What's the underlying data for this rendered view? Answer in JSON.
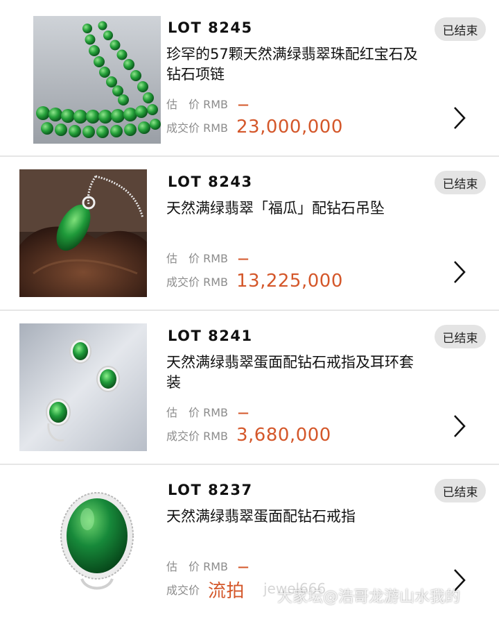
{
  "lots": [
    {
      "lot": "LOT 8245",
      "title": "珍罕的57颗天然满绿翡翠珠配红宝石及钻石项链",
      "status": "已结束",
      "estimate_label": "估　价 RMB",
      "estimate_value": "—",
      "sold_label": "成交价 RMB",
      "sold_value": "23,000,000"
    },
    {
      "lot": "LOT 8243",
      "title": "天然满绿翡翠「福瓜」配钻石吊坠",
      "status": "已结束",
      "estimate_label": "估　价 RMB",
      "estimate_value": "—",
      "sold_label": "成交价 RMB",
      "sold_value": "13,225,000"
    },
    {
      "lot": "LOT 8241",
      "title": "天然满绿翡翠蛋面配钻石戒指及耳环套装",
      "status": "已结束",
      "estimate_label": "估　价 RMB",
      "estimate_value": "—",
      "sold_label": "成交价 RMB",
      "sold_value": "3,680,000"
    },
    {
      "lot": "LOT 8237",
      "title": "天然满绿翡翠蛋面配钻石戒指",
      "status": "已结束",
      "estimate_label": "估　价 RMB",
      "estimate_value": "—",
      "sold_label": "成交价",
      "sold_value": "流拍"
    }
  ],
  "watermark": {
    "text": "大家坛@浩哥龙游山水我的",
    "faint": "jewel666"
  },
  "colors": {
    "accent": "#d4572a",
    "badge_bg": "#e4e4e4",
    "divider": "#e6e6e6",
    "jade": "#1f9a3a"
  }
}
